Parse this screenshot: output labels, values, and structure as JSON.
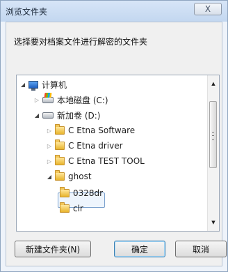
{
  "window": {
    "title": "浏览文件夹",
    "close_label": "X"
  },
  "prompt": "选择要对档案文件进行解密的文件夹",
  "tree": {
    "items": [
      {
        "label": "计算机",
        "icon": "computer-icon",
        "expanded": true,
        "depth": 0
      },
      {
        "label": "本地磁盘 (C:)",
        "icon": "drive-c-icon",
        "expanded": false,
        "depth": 1
      },
      {
        "label": "新加卷 (D:)",
        "icon": "drive-d-icon",
        "expanded": true,
        "depth": 1
      },
      {
        "label": "C Etna  Software",
        "icon": "folder-icon",
        "expanded": false,
        "depth": 2
      },
      {
        "label": "C Etna driver",
        "icon": "folder-icon",
        "expanded": false,
        "depth": 2
      },
      {
        "label": "C Etna TEST TOOL",
        "icon": "folder-icon",
        "expanded": false,
        "depth": 2
      },
      {
        "label": "ghost",
        "icon": "folder-icon",
        "expanded": true,
        "depth": 2
      },
      {
        "label": "0328dr",
        "icon": "folder-icon",
        "selected": true,
        "depth": 3
      },
      {
        "label": "clr",
        "icon": "folder-icon",
        "depth": 3
      }
    ]
  },
  "buttons": {
    "new_folder": "新建文件夹(N)",
    "ok": "确定",
    "cancel": "取消"
  }
}
